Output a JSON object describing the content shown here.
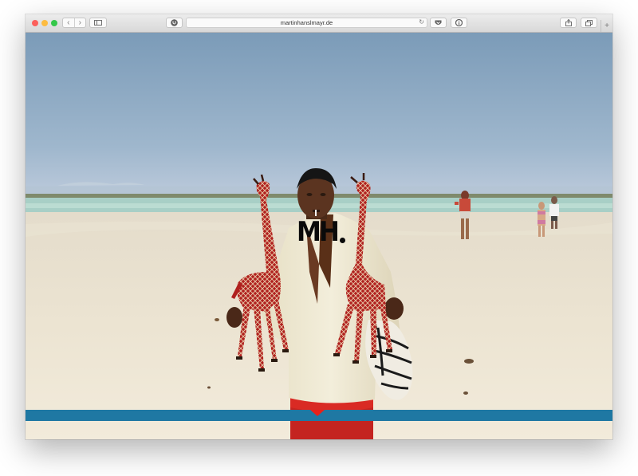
{
  "browser": {
    "url": "martinhanslmayr.de",
    "icons": {
      "back": "chevron-left-icon",
      "forward": "chevron-right-icon",
      "sidebar": "sidebar-icon",
      "extension": "ublock-icon",
      "reload": "reload-icon",
      "pocket": "pocket-icon",
      "info": "info-icon",
      "share": "share-icon",
      "tabs": "tabs-icon",
      "new_tab": "plus-icon"
    }
  },
  "page": {
    "logo_text": "MH",
    "colors": {
      "bar": "#1f78a3",
      "accent": "#e7211a"
    }
  }
}
